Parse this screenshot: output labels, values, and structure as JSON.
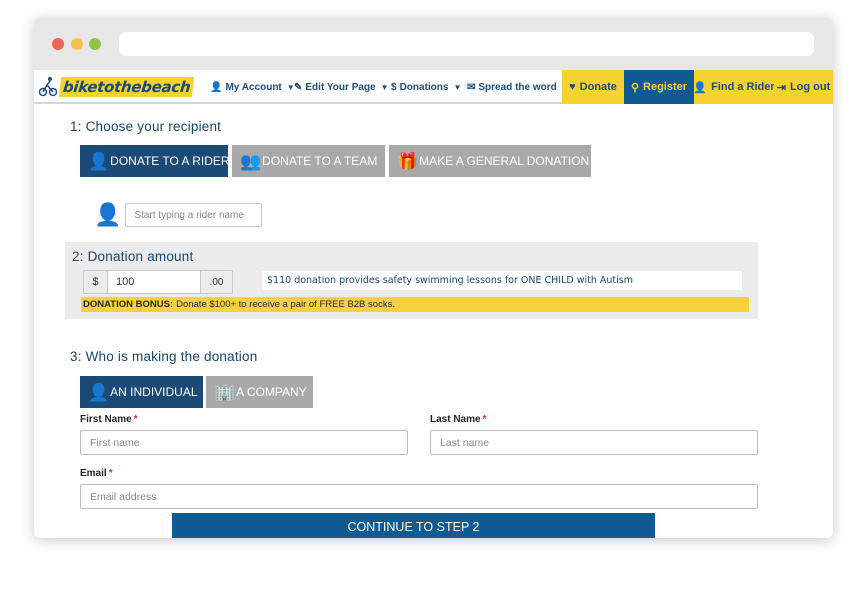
{
  "nav": {
    "logo_text": "biketothebeach",
    "my_account": "My Account",
    "edit_page": "Edit Your Page",
    "donations": "Donations",
    "spread": "Spread the word",
    "donate": "Donate",
    "register": "Register",
    "find_rider": "Find a Rider",
    "logout": "Log out"
  },
  "step1": {
    "title": "1: Choose your recipient",
    "tabs": [
      "DONATE TO A RIDER",
      "DONATE TO A TEAM",
      "MAKE A GENERAL DONATION"
    ],
    "active_tab": 0,
    "rider_placeholder": "Start typing a rider name"
  },
  "step2": {
    "title": "2: Donation amount",
    "currency": "$",
    "amount": "100",
    "cents": ".00",
    "impact_text": "$110 donation provides safety swimming lessons for ONE CHILD with Autism",
    "bonus_label": "DONATION BONUS:",
    "bonus_text": "Donate $100+ to receive a pair of FREE B2B socks."
  },
  "step3": {
    "title": "3: Who is making the donation",
    "tabs": [
      "AN INDIVIDUAL",
      "A COMPANY"
    ],
    "active_tab": 0,
    "first_name_label": "First Name",
    "first_name_placeholder": "First name",
    "last_name_label": "Last Name",
    "last_name_placeholder": "Last name",
    "email_label": "Email",
    "email_placeholder": "Email address",
    "required_mark": "*"
  },
  "continue_label": "CONTINUE TO STEP 2",
  "colors": {
    "brand_blue": "#0f5a91",
    "dark_blue": "#1c4a77",
    "brand_yellow": "#f6d230",
    "inactive_tab": "#a9a9a9"
  }
}
